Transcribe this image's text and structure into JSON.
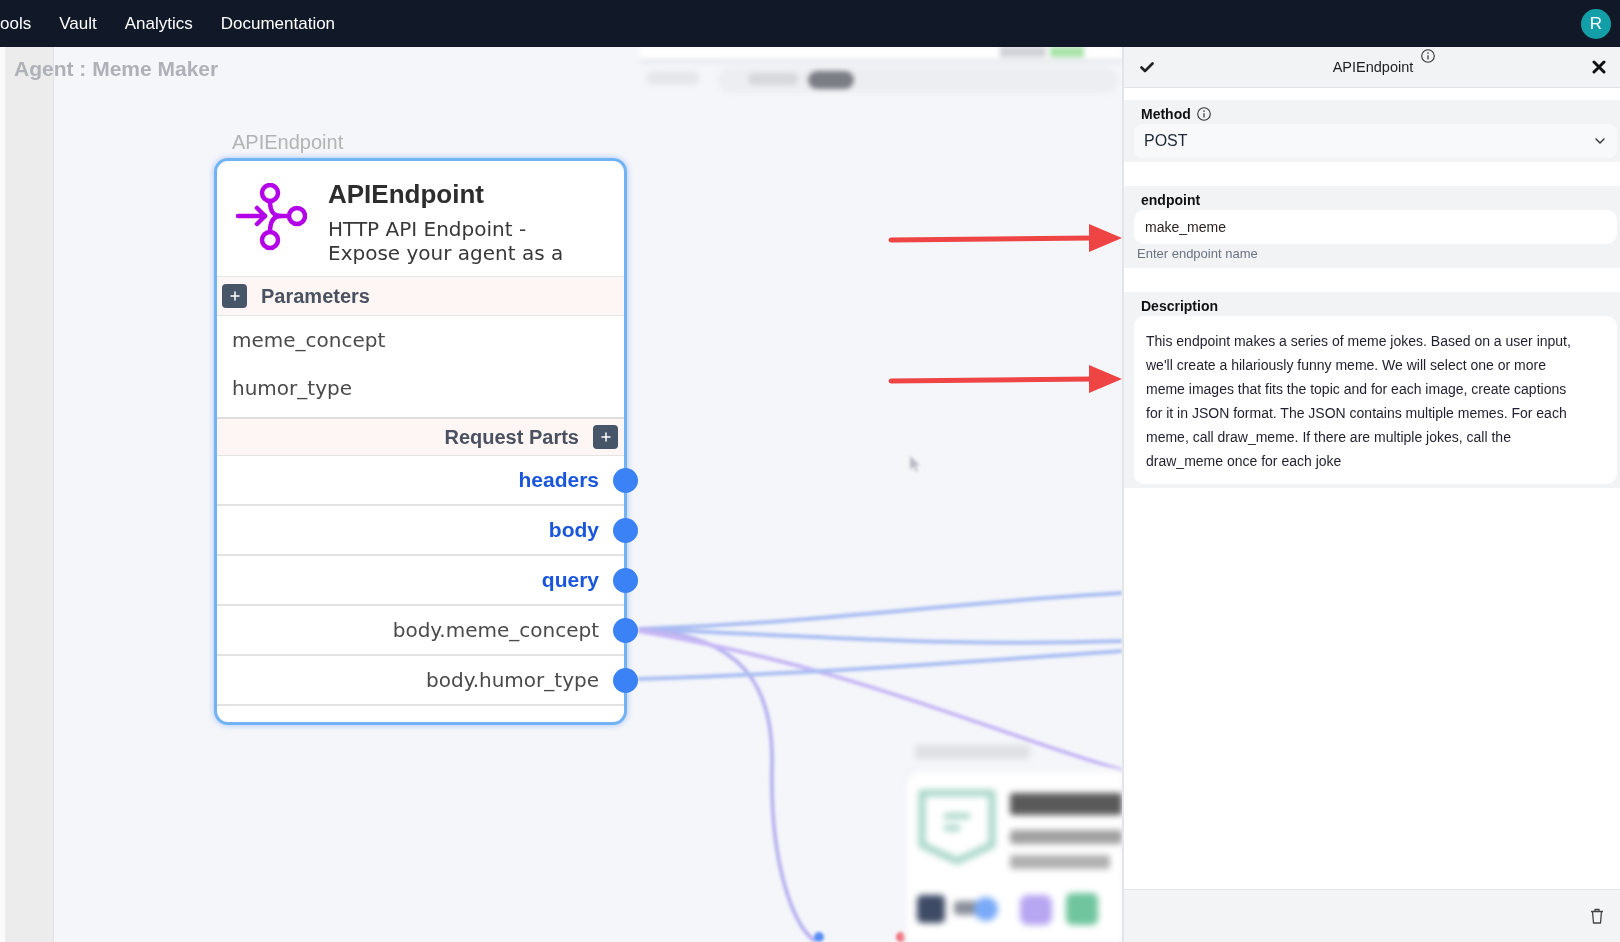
{
  "nav": {
    "items": [
      "ools",
      "Vault",
      "Analytics",
      "Documentation"
    ],
    "avatar": "R"
  },
  "canvas": {
    "title": "Agent : Meme Maker",
    "node": {
      "label": "APIEndpoint",
      "title": "APIEndpoint",
      "subtitle_lines": [
        "HTTP API Endpoint -",
        "Expose your agent as a"
      ],
      "parameters": {
        "title": "Parameters",
        "items": [
          "meme_concept",
          "humor_type"
        ]
      },
      "request_parts": {
        "title": "Request Parts",
        "items": [
          {
            "label": "headers",
            "kind": "builtin"
          },
          {
            "label": "body",
            "kind": "builtin"
          },
          {
            "label": "query",
            "kind": "builtin"
          },
          {
            "label": "body.meme_concept",
            "kind": "custom"
          },
          {
            "label": "body.humor_type",
            "kind": "custom"
          }
        ]
      }
    }
  },
  "panel": {
    "header": {
      "title": "APIEndpoint",
      "info": true
    },
    "fields": [
      {
        "kind": "select",
        "label": "Method",
        "info": true,
        "value": "POST"
      },
      {
        "kind": "input",
        "label": "endpoint",
        "info": false,
        "value": "make_meme",
        "helper": "Enter endpoint name"
      },
      {
        "kind": "textarea",
        "label": "Description",
        "info": false,
        "value_lines": [
          "This endpoint makes a series of meme jokes. Based on a user input,",
          "we'll create a hilariously funny meme. We will select one or more",
          "meme images that fits the topic and for each image, create captions",
          "for it in JSON format. The JSON contains multiple memes. For each",
          "meme, call draw_meme. If there are multiple jokes, call the",
          "draw_meme once for each joke"
        ]
      }
    ]
  }
}
